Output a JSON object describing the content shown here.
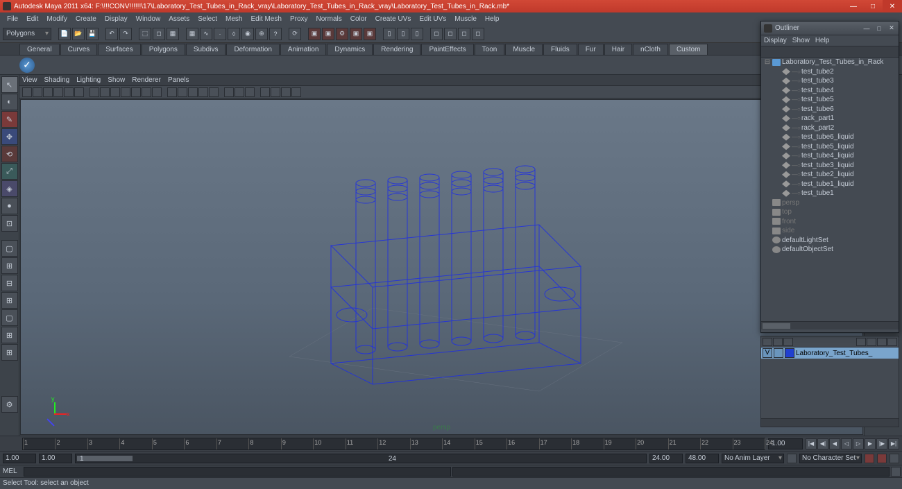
{
  "title": "Autodesk Maya 2011 x64: F:\\!!!CONV!!!!!!\\17\\Laboratory_Test_Tubes_in_Rack_vray\\Laboratory_Test_Tubes_in_Rack_vray\\Laboratory_Test_Tubes_in_Rack.mb*",
  "menubar": [
    "File",
    "Edit",
    "Modify",
    "Create",
    "Display",
    "Window",
    "Assets",
    "Select",
    "Mesh",
    "Edit Mesh",
    "Proxy",
    "Normals",
    "Color",
    "Create UVs",
    "Edit UVs",
    "Muscle",
    "Help"
  ],
  "mode_combo": "Polygons",
  "shelf_tabs": [
    "General",
    "Curves",
    "Surfaces",
    "Polygons",
    "Subdivs",
    "Deformation",
    "Animation",
    "Dynamics",
    "Rendering",
    "PaintEffects",
    "Toon",
    "Muscle",
    "Fluids",
    "Fur",
    "Hair",
    "nCloth",
    "Custom"
  ],
  "shelf_active": "Custom",
  "viewport_menu": [
    "View",
    "Shading",
    "Lighting",
    "Show",
    "Renderer",
    "Panels"
  ],
  "camera_label": "persp",
  "outliner": {
    "title": "Outliner",
    "menu": [
      "Display",
      "Show",
      "Help"
    ],
    "root": "Laboratory_Test_Tubes_in_Rack",
    "items": [
      "test_tube2",
      "test_tube3",
      "test_tube4",
      "test_tube5",
      "test_tube6",
      "rack_part1",
      "rack_part2",
      "test_tube6_liquid",
      "test_tube5_liquid",
      "test_tube4_liquid",
      "test_tube3_liquid",
      "test_tube2_liquid",
      "test_tube1_liquid",
      "test_tube1"
    ],
    "cameras": [
      "persp",
      "top",
      "front",
      "side"
    ],
    "sets": [
      "defaultLightSet",
      "defaultObjectSet"
    ]
  },
  "layer_name": "Laboratory_Test_Tubes_",
  "time": {
    "ticks": [
      "1",
      "2",
      "3",
      "4",
      "5",
      "6",
      "7",
      "8",
      "9",
      "10",
      "11",
      "12",
      "13",
      "14",
      "15",
      "16",
      "17",
      "18",
      "19",
      "20",
      "21",
      "22",
      "23",
      "24"
    ],
    "end_field": "1.00",
    "range_start": "1.00",
    "range_start2": "1.00",
    "range_cur": "1",
    "range_cur_end": "24",
    "range_end": "24.00",
    "range_end2": "48.00",
    "anim_layer": "No Anim Layer",
    "char_set": "No Character Set"
  },
  "cmd_label": "MEL",
  "helpline": "Select Tool: select an object"
}
